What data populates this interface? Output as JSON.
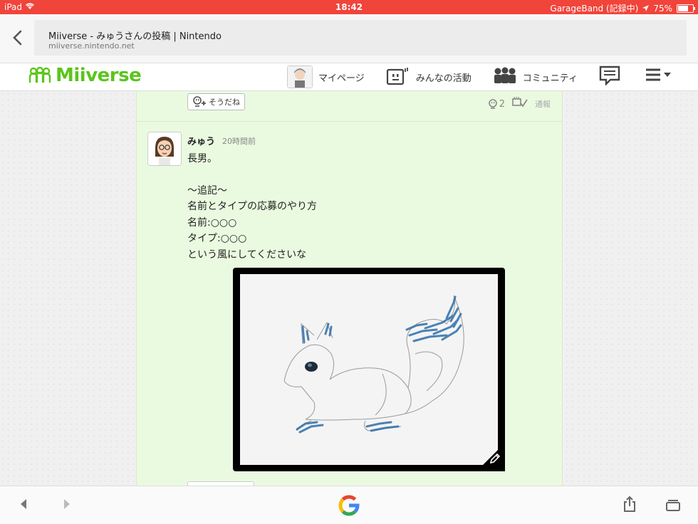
{
  "status_bar": {
    "device": "iPad",
    "time": "18:42",
    "app_status": "GarageBand (記録中)",
    "battery": "75%",
    "battery_level": 0.75
  },
  "browser": {
    "page_title": "Miiverse - みゅうさんの投稿 | Nintendo",
    "host": "miiverse.nintendo.net"
  },
  "miiverse": {
    "logo_text": "Miiverse",
    "nav": {
      "mypage": "マイページ",
      "activity": "みんなの活動",
      "community": "コミュニティ"
    }
  },
  "prev_post": {
    "empathy_label": "そうだね",
    "empathy_count": "2",
    "report_label": "通報"
  },
  "post": {
    "user": "みゅう",
    "time": "20時間前",
    "lines": [
      "長男。",
      "",
      "〜追記〜",
      "名前とタイプの応募のやり方",
      "名前:○○○",
      "タイプ:○○○",
      "という風にしてくださいな"
    ]
  },
  "colors": {
    "status_bar": "#f1443b",
    "miiverse_green": "#5ac51c",
    "column_bg": "#eafae0",
    "drawing_blue": "#2e6fa8"
  }
}
